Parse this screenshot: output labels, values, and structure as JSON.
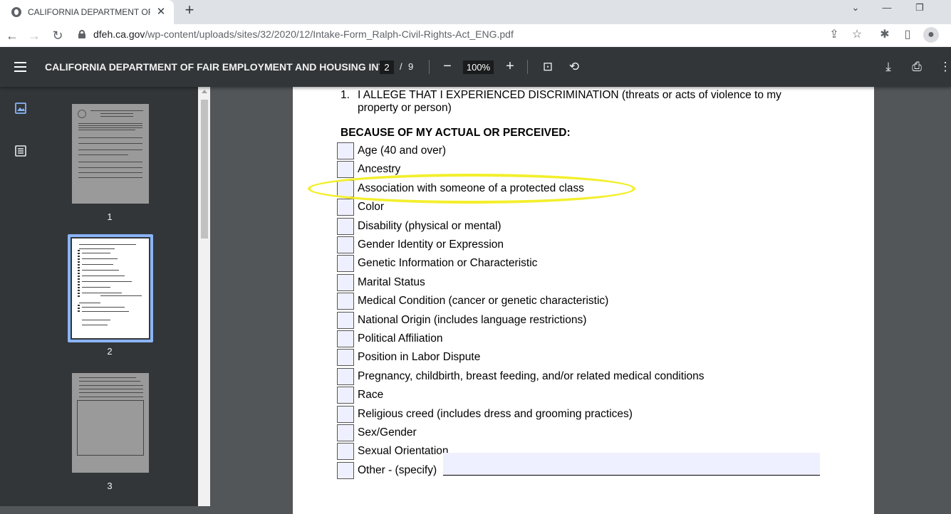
{
  "browser": {
    "tab_title": "CALIFORNIA DEPARTMENT OF FA",
    "url_host": "dfeh.ca.gov",
    "url_path": "/wp-content/uploads/sites/32/2020/12/Intake-Form_Ralph-Civil-Rights-Act_ENG.pdf"
  },
  "viewer": {
    "title": "CALIFORNIA DEPARTMENT OF FAIR EMPLOYMENT AND HOUSING INT...",
    "current_page": "2",
    "page_separator": "/",
    "total_pages": "9",
    "zoom": "100%"
  },
  "thumbnails": [
    {
      "label": "1"
    },
    {
      "label": "2"
    },
    {
      "label": "3"
    }
  ],
  "document": {
    "question_number": "1.",
    "question_text": "I ALLEGE THAT I EXPERIENCED DISCRIMINATION (threats or acts of violence to my property or person)",
    "heading": "BECAUSE OF MY ACTUAL OR PERCEIVED:",
    "options": [
      "Age (40 and over)",
      "Ancestry",
      "Association with someone of a protected class",
      "Color",
      "Disability (physical or mental)",
      "Gender Identity or Expression",
      "Genetic Information or Characteristic",
      "Marital Status",
      "Medical Condition (cancer or genetic characteristic)",
      "National Origin (includes language restrictions)",
      "Political Affiliation",
      "Position in Labor Dispute",
      "Pregnancy, childbirth, breast feeding, and/or related medical conditions",
      "Race",
      "Religious creed (includes dress and grooming practices)",
      "Sex/Gender",
      "Sexual Orientation",
      "Other - (specify)"
    ],
    "specify_value": ""
  },
  "colors": {
    "toolbar": "#323639",
    "highlight_circle": "#f3ef2c",
    "field_fill": "#eef0ff",
    "thumb_selected": "#8ab4f8"
  }
}
